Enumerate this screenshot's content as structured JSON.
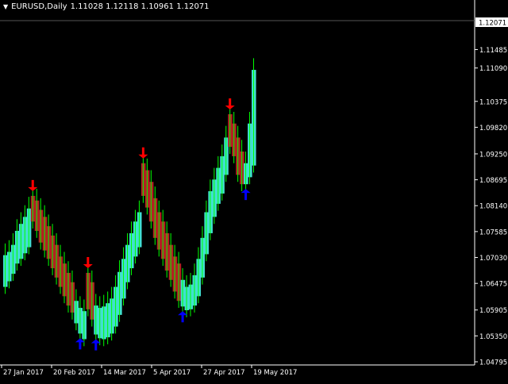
{
  "header": {
    "menu_icon": "triangle-down-icon",
    "symbol": "EURUSD,Daily",
    "ohlc": "1.11028 1.12118 1.10961 1.12071"
  },
  "colors": {
    "background": "#000000",
    "axis": "#ffffff",
    "bull_band": "#40e0d0",
    "bear_band": "#b22222",
    "wick": "#00ff00",
    "sell_arrow": "#ff0000",
    "buy_arrow": "#0000ff",
    "price_label_bg": "#ffffff",
    "price_label_text": "#000000"
  },
  "price_axis": {
    "ticks": [
      "1.11485",
      "1.11090",
      "1.10375",
      "1.09820",
      "1.09250",
      "1.08695",
      "1.08140",
      "1.07585",
      "1.07030",
      "1.06475",
      "1.05905",
      "1.05350",
      "1.04795"
    ],
    "current_price": "1.12071"
  },
  "time_axis": {
    "labels": [
      "27 Jan 2017",
      "20 Feb 2017",
      "14 Mar 2017",
      "5 Apr 2017",
      "27 Apr 2017",
      "19 May 2017"
    ]
  },
  "chart_data": {
    "type": "band",
    "description_free": true,
    "ylim": [
      1.04795,
      1.12071
    ],
    "bars": [
      {
        "hi": 1.0708,
        "lo": 1.064,
        "c": "bull"
      },
      {
        "hi": 1.0715,
        "lo": 1.0652,
        "c": "bull"
      },
      {
        "hi": 1.073,
        "lo": 1.0668,
        "c": "bull"
      },
      {
        "hi": 1.076,
        "lo": 1.069,
        "c": "bull"
      },
      {
        "hi": 1.0775,
        "lo": 1.07,
        "c": "bull"
      },
      {
        "hi": 1.079,
        "lo": 1.0712,
        "c": "bull"
      },
      {
        "hi": 1.0808,
        "lo": 1.0725,
        "c": "bull"
      },
      {
        "hi": 1.0835,
        "lo": 1.078,
        "c": "bear"
      },
      {
        "hi": 1.0825,
        "lo": 1.076,
        "c": "bear"
      },
      {
        "hi": 1.0805,
        "lo": 1.0735,
        "c": "bear"
      },
      {
        "hi": 1.079,
        "lo": 1.0718,
        "c": "bear"
      },
      {
        "hi": 1.077,
        "lo": 1.07,
        "c": "bear"
      },
      {
        "hi": 1.075,
        "lo": 1.068,
        "c": "bear"
      },
      {
        "hi": 1.073,
        "lo": 1.066,
        "c": "bear"
      },
      {
        "hi": 1.0705,
        "lo": 1.064,
        "c": "bear"
      },
      {
        "hi": 1.069,
        "lo": 1.062,
        "c": "bear"
      },
      {
        "hi": 1.067,
        "lo": 1.06,
        "c": "bear"
      },
      {
        "hi": 1.065,
        "lo": 1.0585,
        "c": "bear"
      },
      {
        "hi": 1.061,
        "lo": 1.0562,
        "c": "bull"
      },
      {
        "hi": 1.0595,
        "lo": 1.054,
        "c": "bull"
      },
      {
        "hi": 1.0588,
        "lo": 1.0528,
        "c": "bull"
      },
      {
        "hi": 1.067,
        "lo": 1.0592,
        "c": "bear"
      },
      {
        "hi": 1.065,
        "lo": 1.057,
        "c": "bear"
      },
      {
        "hi": 1.06,
        "lo": 1.0538,
        "c": "bull"
      },
      {
        "hi": 1.0595,
        "lo": 1.053,
        "c": "bull"
      },
      {
        "hi": 1.0598,
        "lo": 1.0528,
        "c": "bull"
      },
      {
        "hi": 1.0605,
        "lo": 1.0532,
        "c": "bull"
      },
      {
        "hi": 1.0615,
        "lo": 1.054,
        "c": "bull"
      },
      {
        "hi": 1.064,
        "lo": 1.0555,
        "c": "bull"
      },
      {
        "hi": 1.0672,
        "lo": 1.058,
        "c": "bull"
      },
      {
        "hi": 1.07,
        "lo": 1.0615,
        "c": "bull"
      },
      {
        "hi": 1.073,
        "lo": 1.065,
        "c": "bull"
      },
      {
        "hi": 1.0755,
        "lo": 1.068,
        "c": "bull"
      },
      {
        "hi": 1.078,
        "lo": 1.0705,
        "c": "bull"
      },
      {
        "hi": 1.08,
        "lo": 1.0725,
        "c": "bull"
      },
      {
        "hi": 1.0905,
        "lo": 1.0835,
        "c": "bear"
      },
      {
        "hi": 1.089,
        "lo": 1.081,
        "c": "bear"
      },
      {
        "hi": 1.0865,
        "lo": 1.078,
        "c": "bear"
      },
      {
        "hi": 1.083,
        "lo": 1.0745,
        "c": "bear"
      },
      {
        "hi": 1.08,
        "lo": 1.072,
        "c": "bear"
      },
      {
        "hi": 1.078,
        "lo": 1.07,
        "c": "bear"
      },
      {
        "hi": 1.0755,
        "lo": 1.0675,
        "c": "bear"
      },
      {
        "hi": 1.073,
        "lo": 1.0655,
        "c": "bear"
      },
      {
        "hi": 1.0705,
        "lo": 1.063,
        "c": "bear"
      },
      {
        "hi": 1.069,
        "lo": 1.061,
        "c": "bear"
      },
      {
        "hi": 1.0655,
        "lo": 1.0598,
        "c": "bull"
      },
      {
        "hi": 1.064,
        "lo": 1.059,
        "c": "bull"
      },
      {
        "hi": 1.0645,
        "lo": 1.0592,
        "c": "bull"
      },
      {
        "hi": 1.0665,
        "lo": 1.06,
        "c": "bull"
      },
      {
        "hi": 1.07,
        "lo": 1.062,
        "c": "bull"
      },
      {
        "hi": 1.0745,
        "lo": 1.066,
        "c": "bull"
      },
      {
        "hi": 1.08,
        "lo": 1.071,
        "c": "bull"
      },
      {
        "hi": 1.0845,
        "lo": 1.0755,
        "c": "bull"
      },
      {
        "hi": 1.087,
        "lo": 1.079,
        "c": "bull"
      },
      {
        "hi": 1.0895,
        "lo": 1.0818,
        "c": "bull"
      },
      {
        "hi": 1.092,
        "lo": 1.084,
        "c": "bull"
      },
      {
        "hi": 1.096,
        "lo": 1.088,
        "c": "bull"
      },
      {
        "hi": 1.101,
        "lo": 1.094,
        "c": "bear"
      },
      {
        "hi": 1.099,
        "lo": 1.092,
        "c": "bear"
      },
      {
        "hi": 1.096,
        "lo": 1.088,
        "c": "bear"
      },
      {
        "hi": 1.093,
        "lo": 1.086,
        "c": "bear"
      },
      {
        "hi": 1.0905,
        "lo": 1.086,
        "c": "bull"
      },
      {
        "hi": 1.099,
        "lo": 1.0875,
        "c": "bull"
      },
      {
        "hi": 1.1105,
        "lo": 1.09,
        "c": "bull"
      }
    ],
    "sell_signals": [
      7,
      21,
      35,
      57
    ],
    "buy_signals": [
      19,
      23,
      45,
      61
    ]
  }
}
